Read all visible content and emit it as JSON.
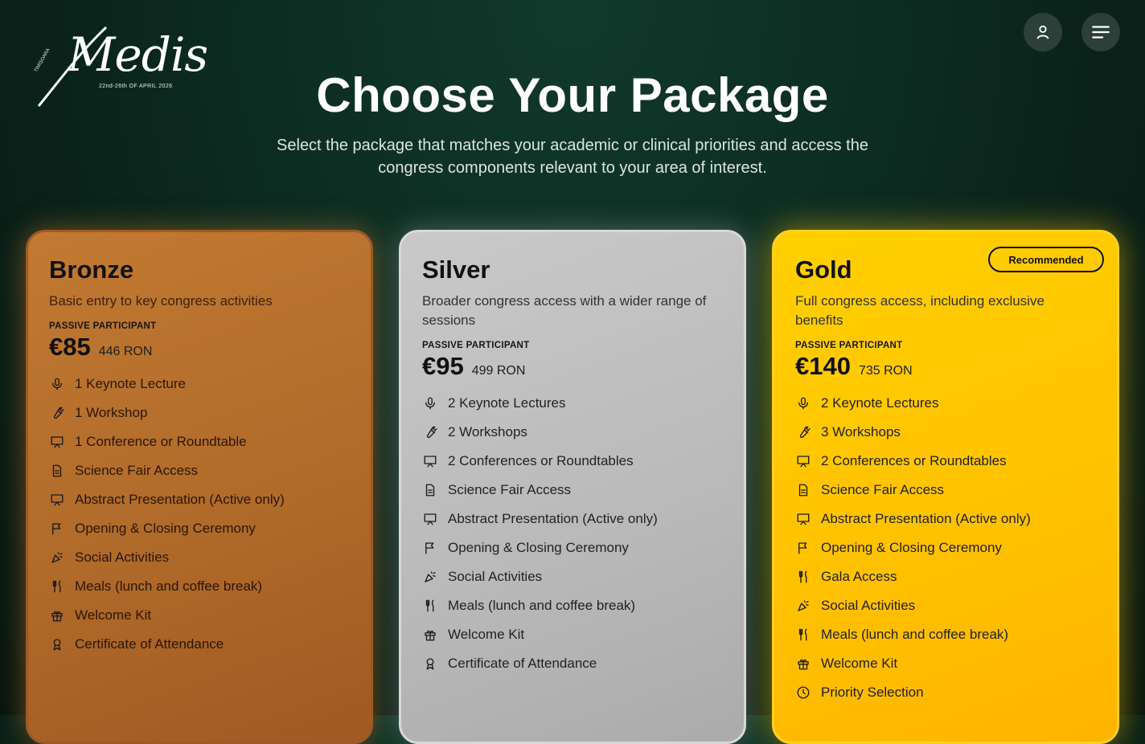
{
  "logo": {
    "script": "Medis",
    "subtitle": "22nd-26th OF APRIL 2026",
    "vertical": "TIMIȘOARA"
  },
  "header": {
    "user_icon": "user-icon",
    "menu_icon": "menu-icon"
  },
  "page": {
    "title": "Choose Your Package",
    "subtitle": "Select the package that matches your academic or clinical priorities and access the congress components relevant to your area of interest."
  },
  "packages": [
    {
      "name": "Bronze",
      "description": "Basic entry to key congress activities",
      "label": "PASSIVE PARTICIPANT",
      "price": "€85",
      "price_ron": "446 RON",
      "features": [
        {
          "icon": "mic",
          "text": "1 Keynote Lecture"
        },
        {
          "icon": "wrench",
          "text": "1 Workshop"
        },
        {
          "icon": "presentation",
          "text": "1 Conference or Roundtable"
        },
        {
          "icon": "document",
          "text": "Science Fair Access"
        },
        {
          "icon": "presentation",
          "text": "Abstract Presentation (Active only)"
        },
        {
          "icon": "flag",
          "text": "Opening & Closing Ceremony"
        },
        {
          "icon": "party",
          "text": "Social Activities"
        },
        {
          "icon": "utensils",
          "text": "Meals (lunch and coffee break)"
        },
        {
          "icon": "gift",
          "text": "Welcome Kit"
        },
        {
          "icon": "award",
          "text": "Certificate of Attendance"
        }
      ]
    },
    {
      "name": "Silver",
      "description": "Broader congress access with a wider range of sessions",
      "label": "PASSIVE PARTICIPANT",
      "price": "€95",
      "price_ron": "499 RON",
      "features": [
        {
          "icon": "mic",
          "text": "2 Keynote Lectures"
        },
        {
          "icon": "wrench",
          "text": "2 Workshops"
        },
        {
          "icon": "presentation",
          "text": "2 Conferences or Roundtables"
        },
        {
          "icon": "document",
          "text": "Science Fair Access"
        },
        {
          "icon": "presentation",
          "text": "Abstract Presentation (Active only)"
        },
        {
          "icon": "flag",
          "text": "Opening & Closing Ceremony"
        },
        {
          "icon": "party",
          "text": "Social Activities"
        },
        {
          "icon": "utensils",
          "text": "Meals (lunch and coffee break)"
        },
        {
          "icon": "gift",
          "text": "Welcome Kit"
        },
        {
          "icon": "award",
          "text": "Certificate of Attendance"
        }
      ]
    },
    {
      "name": "Gold",
      "badge": "Recommended",
      "description": "Full congress access, including exclusive benefits",
      "label": "PASSIVE PARTICIPANT",
      "price": "€140",
      "price_ron": "735 RON",
      "features": [
        {
          "icon": "mic",
          "text": "2 Keynote Lectures"
        },
        {
          "icon": "wrench",
          "text": "3 Workshops"
        },
        {
          "icon": "presentation",
          "text": "2 Conferences or Roundtables"
        },
        {
          "icon": "document",
          "text": "Science Fair Access"
        },
        {
          "icon": "presentation",
          "text": "Abstract Presentation (Active only)"
        },
        {
          "icon": "flag",
          "text": "Opening & Closing Ceremony"
        },
        {
          "icon": "utensils",
          "text": "Gala Access"
        },
        {
          "icon": "party",
          "text": "Social Activities"
        },
        {
          "icon": "utensils",
          "text": "Meals (lunch and coffee break)"
        },
        {
          "icon": "gift",
          "text": "Welcome Kit"
        },
        {
          "icon": "clock",
          "text": "Priority Selection"
        }
      ]
    }
  ]
}
